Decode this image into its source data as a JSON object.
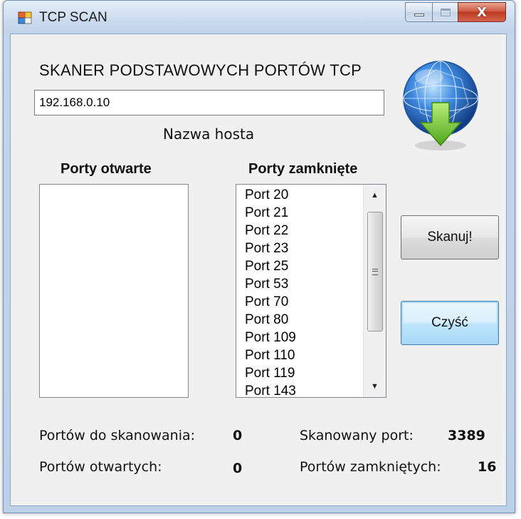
{
  "window": {
    "title": "TCP SCAN",
    "close_glyph": "X"
  },
  "form": {
    "heading": "SKANER PODSTAWOWYCH PORTÓW TCP",
    "host_value": "192.168.0.10",
    "host_label": "Nazwa hosta",
    "open_ports_title": "Porty otwarte",
    "closed_ports_title": "Porty zamknięte",
    "open_ports": [],
    "closed_ports": [
      "Port 20",
      "Port 21",
      "Port 22",
      "Port 23",
      "Port 25",
      "Port 53",
      "Port 70",
      "Port 80",
      "Port 109",
      "Port 110",
      "Port 119",
      "Port 143"
    ]
  },
  "buttons": {
    "scan_label": "Skanuj!",
    "clear_label": "Czyść"
  },
  "stats": {
    "to_scan_label": "Portów do skanowania:",
    "to_scan_value": "0",
    "open_label": "Portów otwartych:",
    "open_value": "0",
    "scanned_port_label": "Skanowany port:",
    "scanned_port_value": "3389",
    "closed_label": "Portów zamkniętych:",
    "closed_value": "16"
  },
  "icons": {
    "app": "app-window-icon",
    "globe": "globe-download-icon",
    "scroll_up": "scroll-up-arrow-icon",
    "scroll_down": "scroll-down-arrow-icon"
  },
  "colors": {
    "globe_blue": "#2f6fc4",
    "arrow_green": "#6bc22e"
  }
}
